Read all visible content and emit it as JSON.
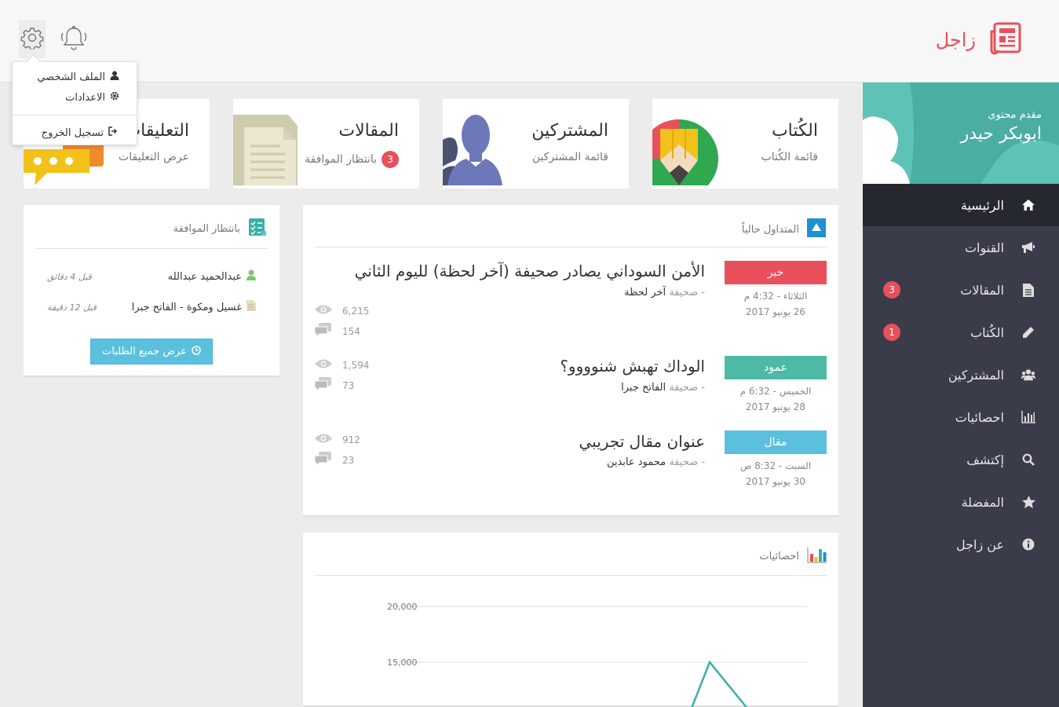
{
  "header": {
    "logo_text": "زاجل"
  },
  "user_menu": {
    "profile": "الملف الشخصي",
    "settings": "الاعدادات",
    "logout": "تسجيل الخروج"
  },
  "sidebar": {
    "role": "مقدم محتوى",
    "name": "ابوبكر حيدر",
    "items": [
      {
        "label": "الرئيسية",
        "icon": "home-icon"
      },
      {
        "label": "القنوات",
        "icon": "megaphone-icon"
      },
      {
        "label": "المقالات",
        "icon": "file-icon",
        "badge": "3"
      },
      {
        "label": "الكُتاب",
        "icon": "pencil-icon",
        "badge": "1"
      },
      {
        "label": "المشتركين",
        "icon": "users-icon"
      },
      {
        "label": "احصائيات",
        "icon": "bar-chart-icon"
      },
      {
        "label": "إكتشف",
        "icon": "search-icon"
      },
      {
        "label": "المفضلة",
        "icon": "star-icon"
      },
      {
        "label": "عن زاجل",
        "icon": "info-icon"
      }
    ]
  },
  "cards": [
    {
      "title": "الكُتاب",
      "sub": "قائمة الكُتاب"
    },
    {
      "title": "المشتركين",
      "sub": "قائمة المشتركين"
    },
    {
      "title": "المقالات",
      "sub": "بانتظار الموافقة",
      "badge": "3"
    },
    {
      "title": "التعليقات",
      "sub": "عرض التعليقات"
    }
  ],
  "pending": {
    "title": "بانتظار الموافقة",
    "rows": [
      {
        "name": "عبدالحميد عبدالله",
        "time": "قبل 4 دقائق"
      },
      {
        "name": "غسيل ومكوة - الفاتح جبرا",
        "time": "قبل 12 دقيقة"
      }
    ],
    "button": "عرض جميع الطلبات"
  },
  "trending": {
    "title": "المتداول حالياً",
    "source_prefix": "- صحيفة",
    "items": [
      {
        "tag": "خبر",
        "tag_color": "#e8505b",
        "date_line1": "الثلاثاء - 4:32 م",
        "date_line2": "26 يونيو 2017",
        "title": "الأمن السوداني يصادر صحيفة (آخر لحظة) لليوم الثاني",
        "source": "آخر لحظة",
        "views": "6,215",
        "comments": "154"
      },
      {
        "tag": "عمود",
        "tag_color": "#4dbaa6",
        "date_line1": "الخميس - 6:32 م",
        "date_line2": "28 يونيو 2017",
        "title": "الوداك تهبش شنوووو؟",
        "source": "الفاتح جبرا",
        "views": "1,594",
        "comments": "73"
      },
      {
        "tag": "مقال",
        "tag_color": "#5bc0de",
        "date_line1": "السبت - 8:32 ص",
        "date_line2": "30 يونيو 2017",
        "title": "عنوان مقال تجريبي",
        "source": "محمود عابدين",
        "views": "912",
        "comments": "23"
      }
    ]
  },
  "stats": {
    "title": "احصائيات"
  },
  "chart_data": {
    "type": "line",
    "y_ticks": [
      "20,000",
      "15,000"
    ],
    "y_tick_values": [
      20000,
      15000
    ],
    "ylim": [
      10000,
      20000
    ],
    "series": [
      {
        "values": [
          10000,
          15000,
          10000
        ]
      }
    ],
    "color": "#3ab0a4"
  }
}
